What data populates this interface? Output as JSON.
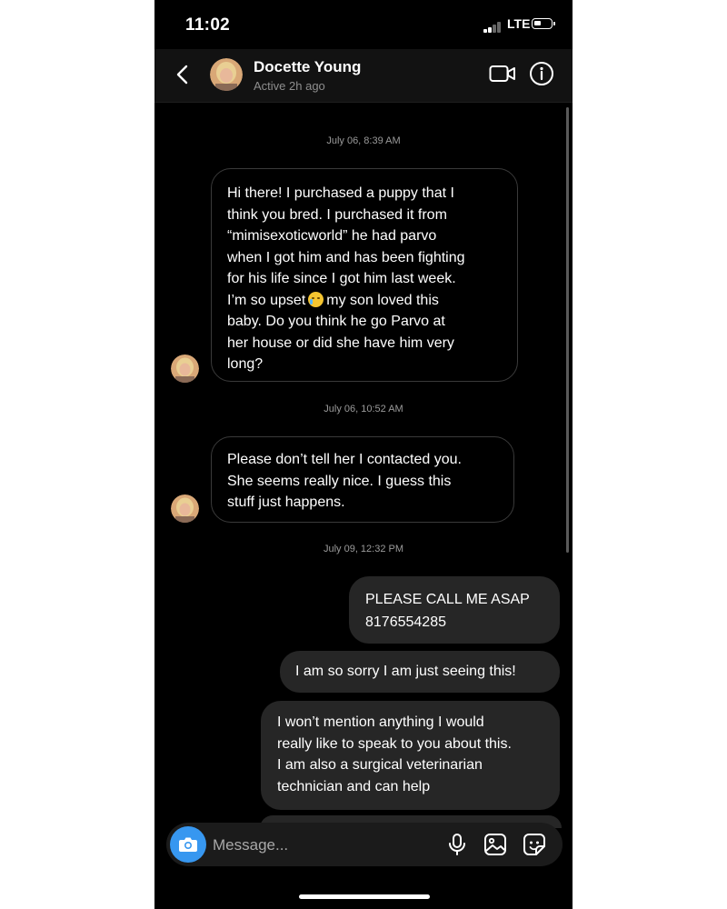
{
  "status_bar": {
    "time": "11:02",
    "network": "LTE"
  },
  "header": {
    "name": "Docette Young",
    "status": "Active 2h ago",
    "icons": [
      "back-icon",
      "video-call-icon",
      "info-icon"
    ]
  },
  "messages": [
    {
      "type": "timestamp",
      "text": "July 06, 8:39 AM"
    },
    {
      "type": "received",
      "lines": [
        "Hi there! I purchased a puppy that I",
        "think you bred. I purchased it from",
        "“mimisexoticworld” he had parvo",
        "when I got him and has been fighting",
        "for his life since I got him last week.",
        "I’m so upset",
        "my son loved this",
        "baby.  Do you think he go Parvo at",
        "her house or did she have him very",
        "long?"
      ],
      "emoji": "crying-face-emoji"
    },
    {
      "type": "timestamp",
      "text": "July 06, 10:52 AM"
    },
    {
      "type": "received",
      "lines": [
        "Please don’t tell her I contacted you.",
        "She seems really nice. I guess this",
        "stuff just happens."
      ]
    },
    {
      "type": "timestamp",
      "text": "July 09, 12:32 PM"
    },
    {
      "type": "sent",
      "lines": [
        "PLEASE CALL ME ASAP",
        "8176554285"
      ]
    },
    {
      "type": "sent",
      "lines": [
        "I am so sorry I am just seeing this!"
      ]
    },
    {
      "type": "sent",
      "lines": [
        "I won’t mention anything I would",
        "really like to speak to you about this.",
        "I am also a surgical veterinarian",
        "technician and can help"
      ]
    }
  ],
  "composer": {
    "placeholder": "Message...",
    "icons": [
      "camera-icon",
      "microphone-icon",
      "gallery-icon",
      "sticker-icon"
    ]
  },
  "colors": {
    "background": "#000000",
    "header": "#121212",
    "sent_bubble": "#262626",
    "received_border": "#3a3a3a",
    "accent": "#3797f0"
  }
}
